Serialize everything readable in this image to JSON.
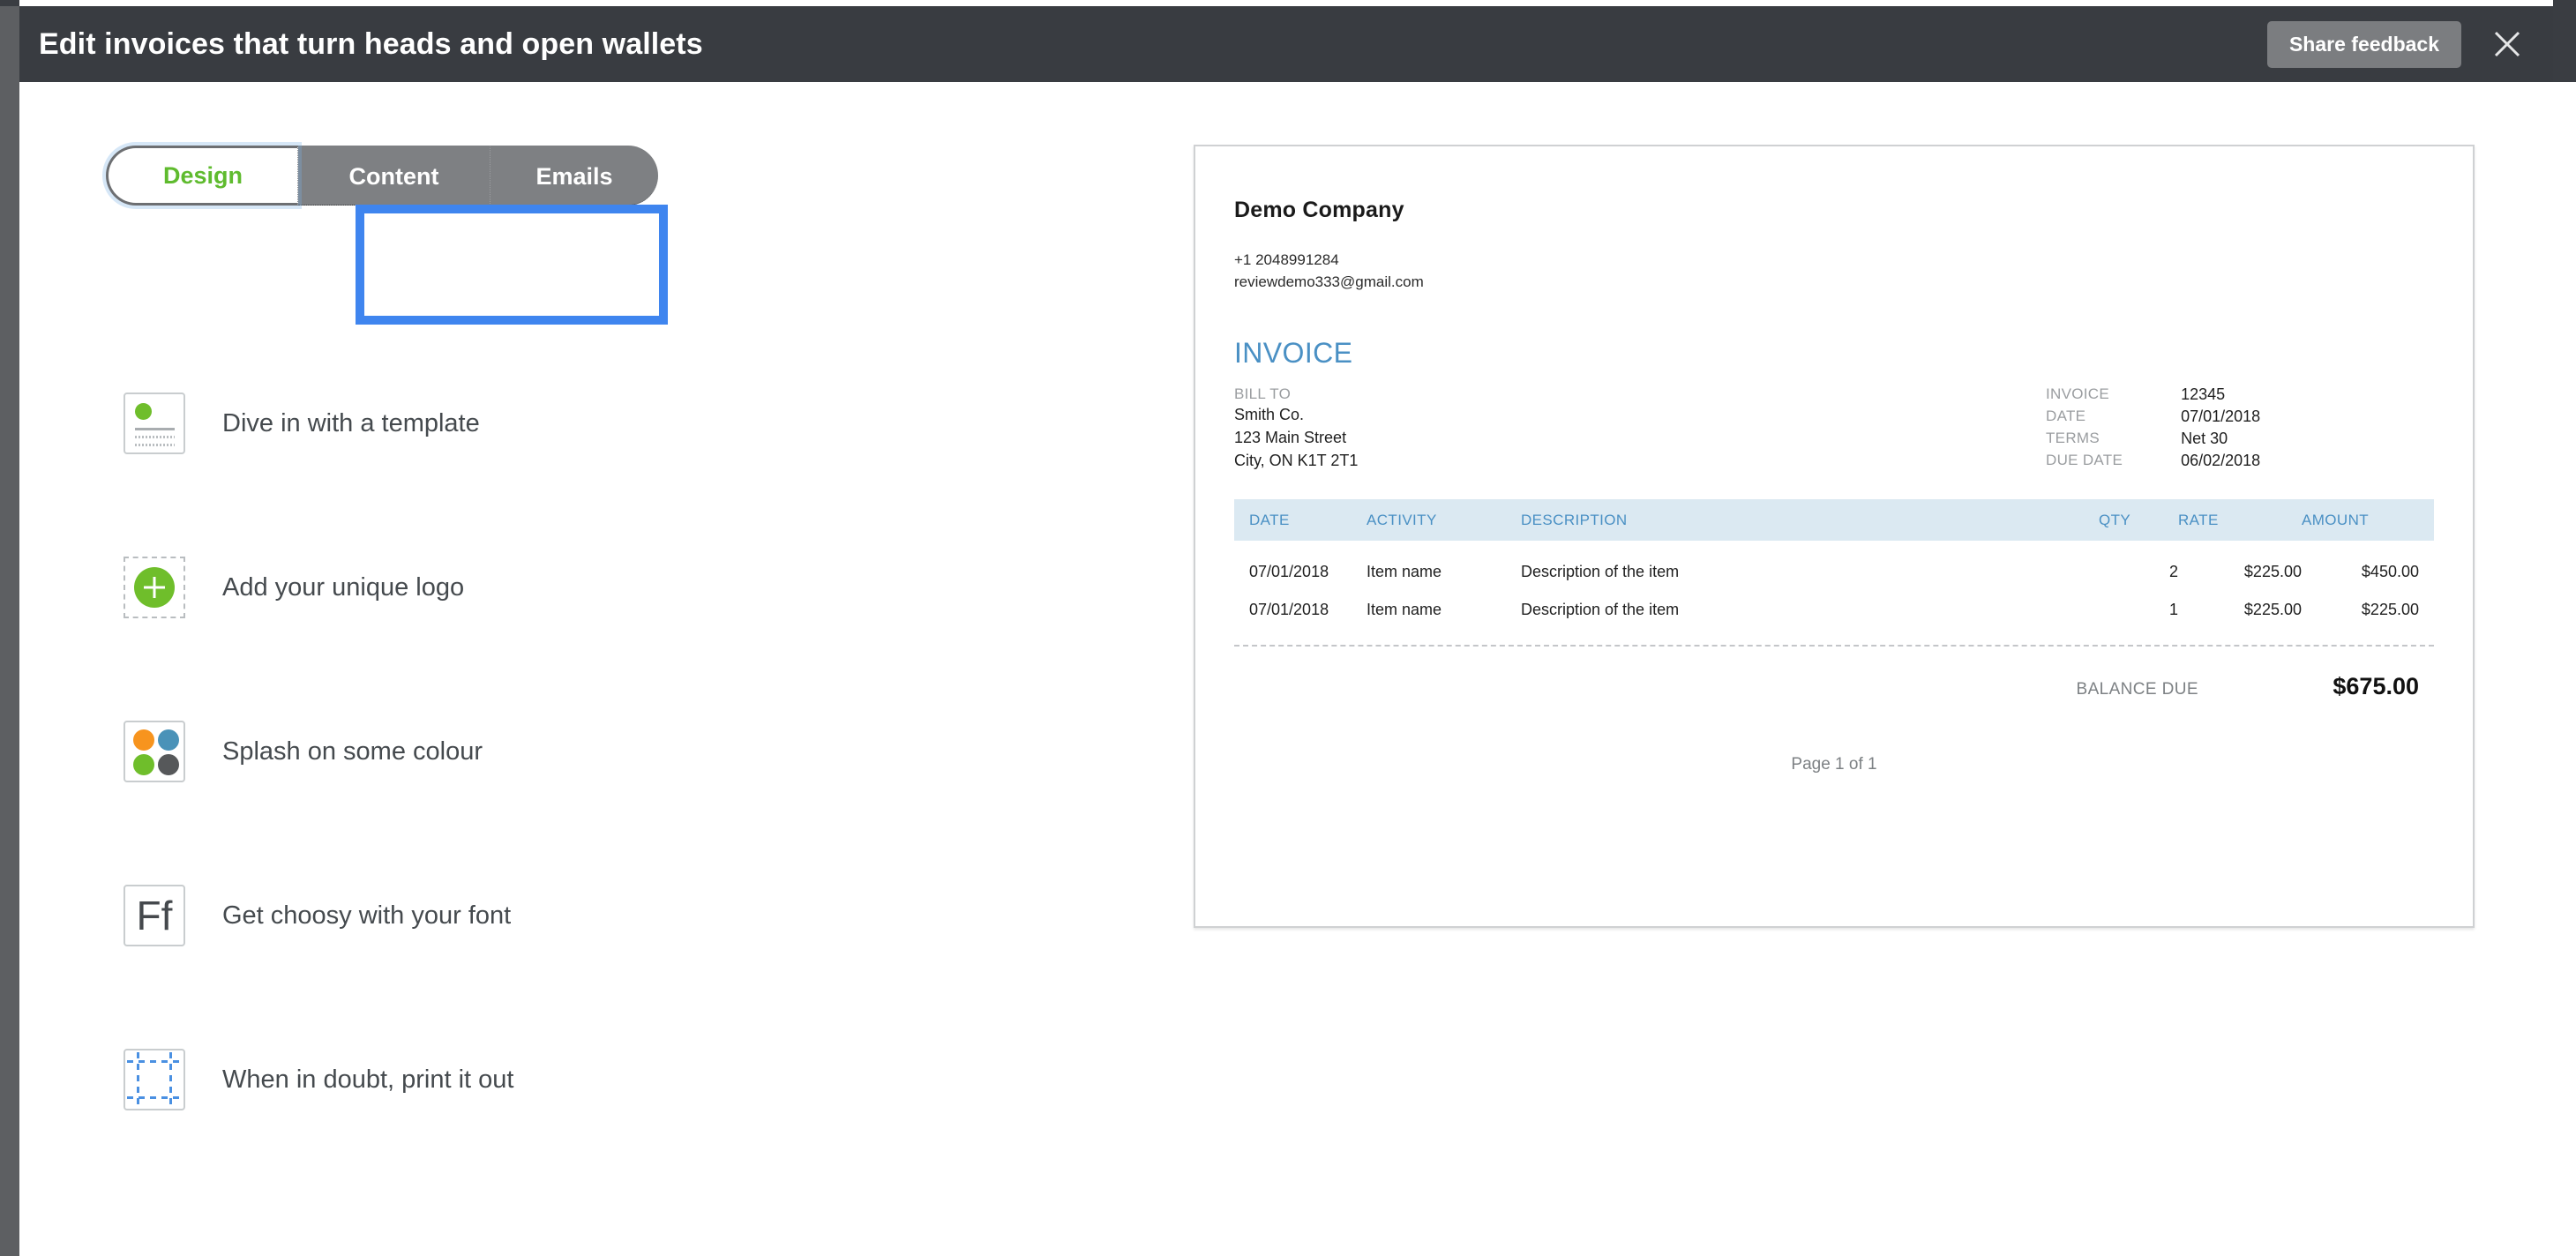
{
  "window": {
    "title": "Edit invoices that turn heads and open wallets",
    "share_feedback_label": "Share feedback",
    "close_icon": "close-icon"
  },
  "tabs": {
    "items": [
      {
        "label": "Design",
        "state": "active"
      },
      {
        "label": "Content",
        "state": "inactive"
      },
      {
        "label": "Emails",
        "state": "inactive"
      }
    ],
    "highlighted": "Content"
  },
  "options": {
    "items": [
      {
        "label": "Dive in with a template",
        "icon": "template-card-icon"
      },
      {
        "label": "Add your unique logo",
        "icon": "add-logo-plus-icon"
      },
      {
        "label": "Splash on some colour",
        "icon": "colour-swatches-icon"
      },
      {
        "label": "Get choosy with your font",
        "icon": "font-Ff-icon",
        "glyph": "Ff"
      },
      {
        "label": "When in doubt, print it out",
        "icon": "print-margins-icon"
      }
    ]
  },
  "invoice": {
    "company_name": "Demo Company",
    "company_phone": "+1 2048991284",
    "company_email": "reviewdemo333@gmail.com",
    "heading": "INVOICE",
    "bill_to_label": "BILL TO",
    "bill_to_lines": [
      "Smith Co.",
      "123 Main Street",
      "City, ON K1T 2T1"
    ],
    "meta": [
      {
        "key": "INVOICE",
        "value": "12345"
      },
      {
        "key": "DATE",
        "value": "07/01/2018"
      },
      {
        "key": "TERMS",
        "value": "Net 30"
      },
      {
        "key": "DUE DATE",
        "value": "06/02/2018"
      }
    ],
    "table": {
      "columns": [
        "DATE",
        "ACTIVITY",
        "DESCRIPTION",
        "QTY",
        "RATE",
        "AMOUNT"
      ],
      "rows": [
        {
          "date": "07/01/2018",
          "activity": "Item name",
          "description": "Description of the item",
          "qty": "2",
          "rate": "$225.00",
          "amount": "$450.00"
        },
        {
          "date": "07/01/2018",
          "activity": "Item name",
          "description": "Description of the item",
          "qty": "1",
          "rate": "$225.00",
          "amount": "$225.00"
        }
      ]
    },
    "balance_due_label": "BALANCE DUE",
    "balance_due_value": "$675.00",
    "page_indicator": "Page 1 of 1"
  },
  "colors": {
    "header_bg": "#393c41",
    "accent_green": "#6fbe2b",
    "accent_blue": "#4a90c4",
    "highlight_blue": "#3f85ef",
    "tab_inactive_bg": "#7e8083",
    "table_header_bg": "#dbe9f2"
  }
}
